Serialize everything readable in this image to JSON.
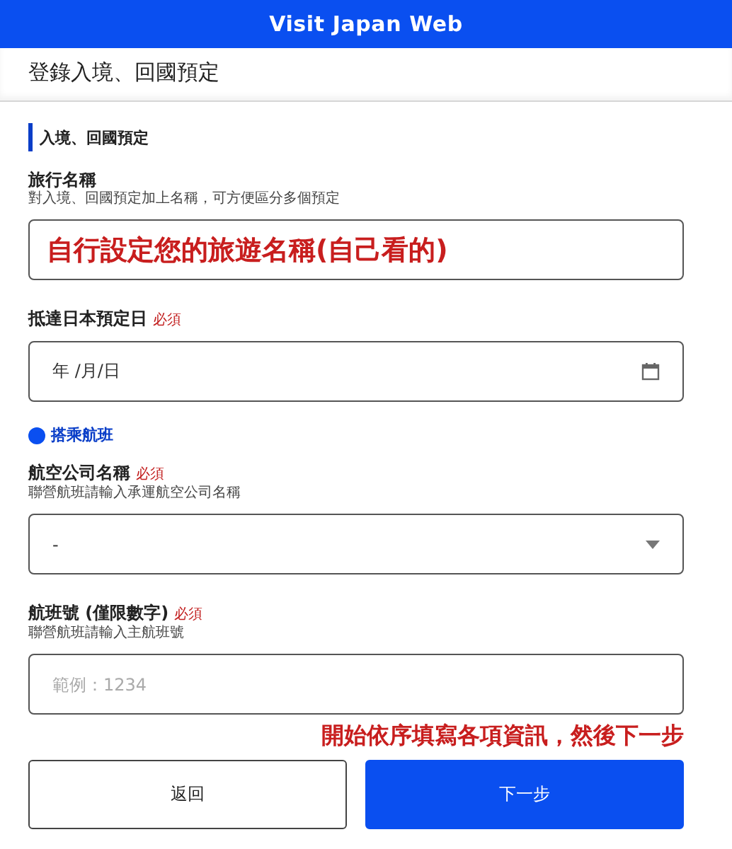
{
  "header": {
    "title": "Visit Japan Web"
  },
  "page_title": "登錄入境、回國預定",
  "section": {
    "title": "入境、回國預定"
  },
  "fields": [
    {
      "kind": "text",
      "label": "旅行名稱",
      "hint": "對入境、回國預定加上名稱，可方便區分多個預定",
      "value": "自行設定您的旅遊名稱(自己看的)"
    },
    {
      "kind": "date",
      "label": "抵達日本預定日",
      "required": "必須",
      "value": "年 /月/日"
    },
    {
      "kind": "subheading",
      "label": "搭乘航班"
    },
    {
      "kind": "select",
      "label": "航空公司名稱",
      "required": "必須",
      "hint": "聯營航班請輸入承運航空公司名稱",
      "value": "-"
    },
    {
      "kind": "number",
      "label": "航班號 (僅限數字)",
      "required": "必須",
      "hint": "聯營航班請輸入主航班號",
      "placeholder": "範例：1234"
    }
  ],
  "annotation": "開始依序填寫各項資訊，然後下一步",
  "buttons": [
    {
      "label": "返回",
      "kind": "secondary"
    },
    {
      "label": "下一步",
      "kind": "primary"
    }
  ]
}
